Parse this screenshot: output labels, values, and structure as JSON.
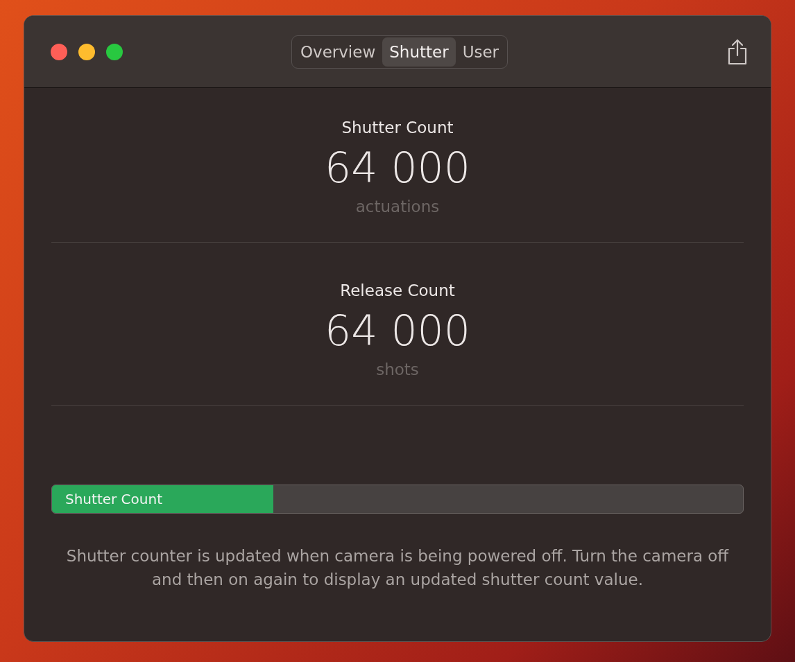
{
  "tabs": [
    {
      "label": "Overview",
      "selected": false
    },
    {
      "label": "Shutter",
      "selected": true
    },
    {
      "label": "User",
      "selected": false
    }
  ],
  "sections": [
    {
      "title": "Shutter Count",
      "value": "64 000",
      "unit": "actuations"
    },
    {
      "title": "Release Count",
      "value": "64 000",
      "unit": "shots"
    }
  ],
  "progress": {
    "label": "Shutter Count",
    "level": 0.32
  },
  "note": "Shutter counter is updated when camera is being powered off. Turn the camera off and then on again to display an updated shutter count value."
}
